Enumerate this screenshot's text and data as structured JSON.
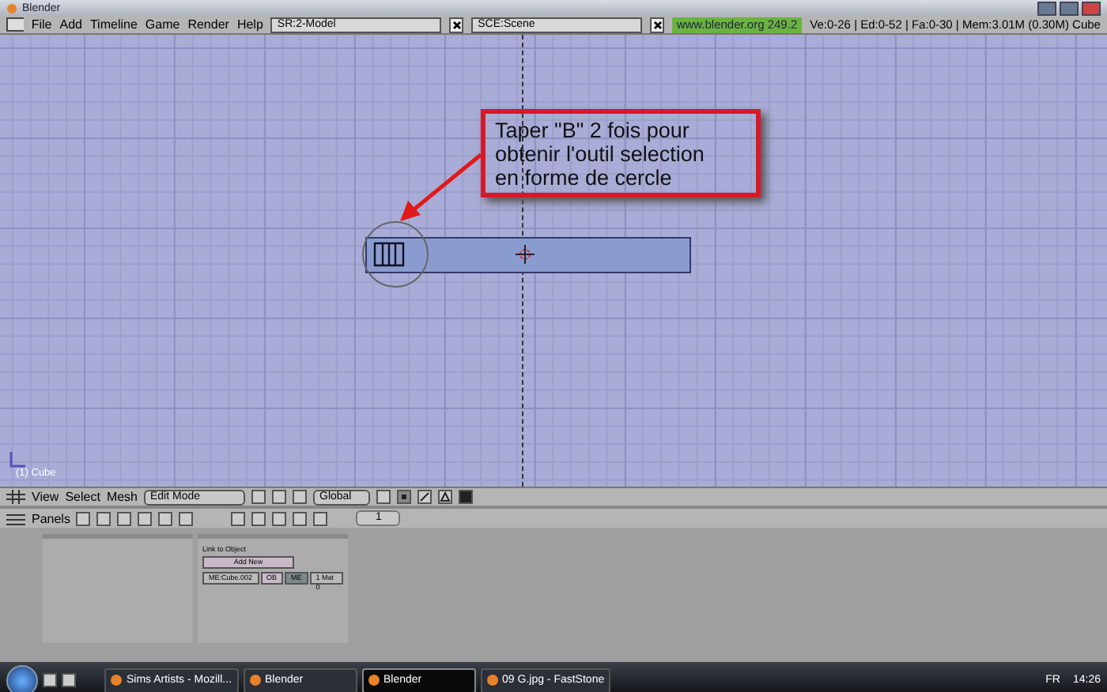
{
  "window": {
    "title": "Blender"
  },
  "header": {
    "menus": [
      "File",
      "Add",
      "Timeline",
      "Game",
      "Render",
      "Help"
    ],
    "screen_field": "SR:2-Model",
    "scene_field": "SCE:Scene",
    "version": "www.blender.org 249.2",
    "stats": "Ve:0-26 | Ed:0-52 | Fa:0-30 | Mem:3.01M (0.30M) Cube"
  },
  "viewport": {
    "object_label": "(1) Cube",
    "annotation": [
      "Taper \"B\" 2 fois pour",
      "obtenir l'outil selection",
      "en forme de cercle"
    ]
  },
  "view_header": {
    "menus": [
      "View",
      "Select",
      "Mesh"
    ],
    "mode": "Edit Mode",
    "orientation": "Global",
    "select_modes": [
      {
        "kind": "vertex",
        "selected": true
      },
      {
        "kind": "edge",
        "selected": false
      },
      {
        "kind": "face",
        "selected": false
      }
    ]
  },
  "buttons_header": {
    "label": "Panels",
    "frame": "1"
  },
  "panels": {
    "link_label": "Link to Object",
    "add_button": "Add New",
    "mesh_name": "ME:Cube.002",
    "ob_toggle": "OB",
    "me_toggle": "ME",
    "material": "1 Mat 0"
  },
  "taskbar": {
    "tasks": [
      {
        "label": "Sims Artists - Mozill...",
        "selected": false
      },
      {
        "label": "Blender",
        "selected": false
      },
      {
        "label": "Blender",
        "selected": true
      },
      {
        "label": "09 G.jpg - FastStone",
        "selected": false
      }
    ],
    "language": "FR",
    "clock": "14:26"
  }
}
